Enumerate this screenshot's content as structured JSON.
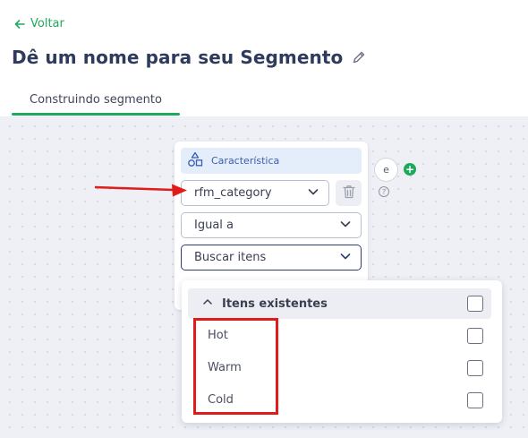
{
  "header": {
    "back_label": "Voltar",
    "title": "Dê um nome para seu Segmento"
  },
  "tabs": [
    {
      "label": "Construindo segmento",
      "active": true
    }
  ],
  "condition": {
    "type_label": "Característica",
    "attribute": "rfm_category",
    "operator": "Igual a",
    "value_placeholder": "Buscar itens",
    "connector": "e"
  },
  "dropdown": {
    "group_label": "Itens existentes",
    "options": [
      {
        "label": "Hot",
        "checked": false
      },
      {
        "label": "Warm",
        "checked": false
      },
      {
        "label": "Cold",
        "checked": false
      }
    ]
  },
  "colors": {
    "accent": "#1fa95b",
    "annotation": "#e11a1a",
    "title": "#2f3b5c"
  },
  "icons": [
    "arrow-left-icon",
    "pencil-icon",
    "shapes-icon",
    "chevron-down-icon",
    "trash-icon",
    "plus-icon",
    "help-icon",
    "chevron-up-icon"
  ]
}
